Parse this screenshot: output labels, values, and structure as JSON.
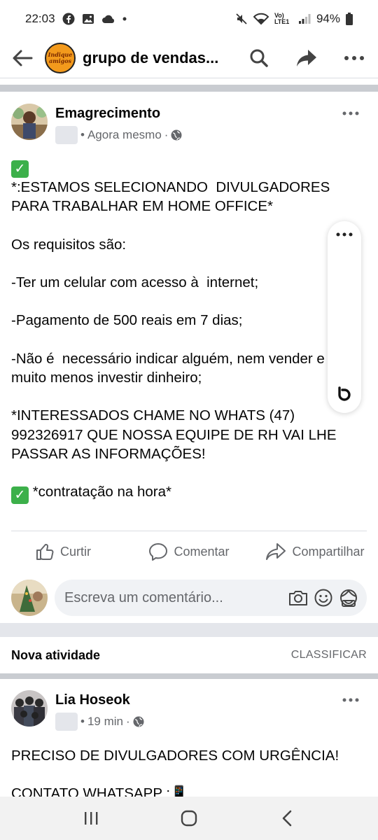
{
  "status_bar": {
    "time": "22:03",
    "battery": "94%",
    "network": "Vo) LTE1"
  },
  "header": {
    "group_name": "grupo de vendas...",
    "group_avatar_text": [
      "Indique",
      "amigos"
    ]
  },
  "post": {
    "author": "Emagrecimento",
    "time": "Agora mesmo",
    "lines": [
      "*:ESTAMOS SELECIONANDO  DIVULGADORES PARA TRABALHAR EM HOME OFFICE*",
      "",
      "Os requisitos são:",
      "",
      "-Ter um celular com acesso à  internet;",
      "",
      "-Pagamento de 500 reais em 7 dias;",
      "",
      "-Não é  necessário indicar alguém, nem vender e muito menos investir dinheiro;",
      "",
      "*INTERESSADOS CHAME NO WHATS (47) 992326917 QUE NOSSA EQUIPE DE RH VAI LHE PASSAR AS INFORMAÇÕES!",
      ""
    ],
    "last_line": " *contratação na hora*"
  },
  "actions": {
    "like": "Curtir",
    "comment": "Comentar",
    "share": "Compartilhar"
  },
  "comment_box": {
    "placeholder": "Escreva um comentário..."
  },
  "activity": {
    "title": "Nova atividade",
    "sort": "CLASSIFICAR"
  },
  "post2": {
    "author": "Lia Hoseok",
    "time": "19 min",
    "line1": "PRECISO DE DIVULGADORES COM URGÊNCIA!",
    "line2": "CONTATO WHATSAPP :📱"
  },
  "colors": {
    "accent": "#1877f2",
    "secondary_text": "#65676b",
    "divider": "#c9ccd1",
    "check_green": "#3cb04a",
    "group_avatar": "#f39a1c"
  }
}
